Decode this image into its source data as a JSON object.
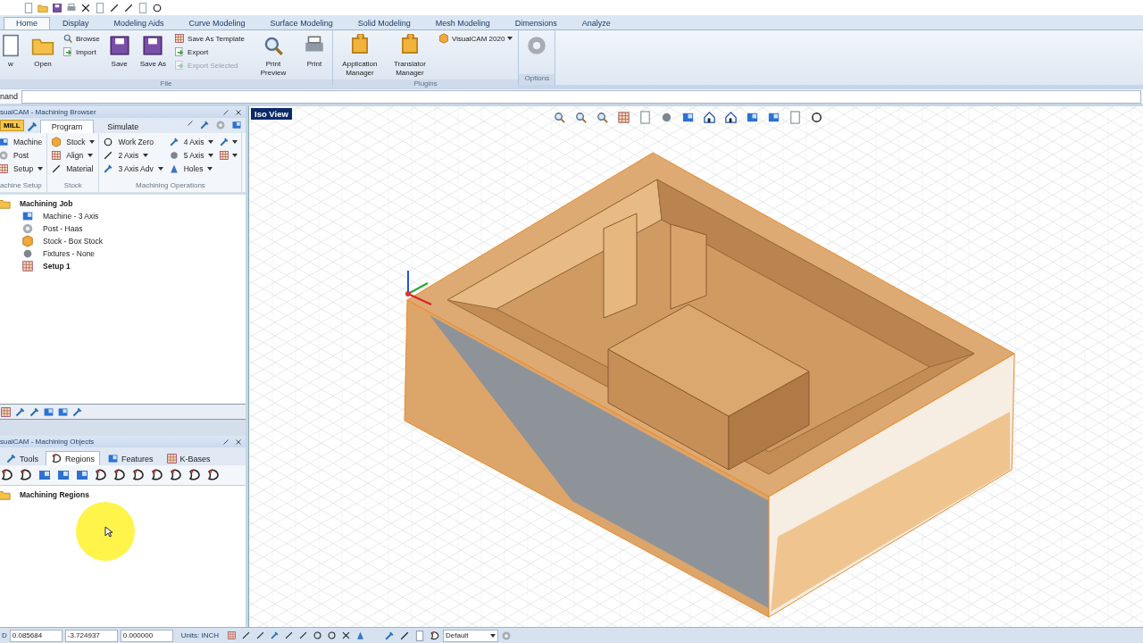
{
  "ribbon": {
    "tabs": [
      {
        "label": "Home",
        "selected": true
      },
      {
        "label": "Display",
        "selected": false
      },
      {
        "label": "Modeling Aids",
        "selected": false
      },
      {
        "label": "Curve Modeling",
        "selected": false
      },
      {
        "label": "Surface Modeling",
        "selected": false
      },
      {
        "label": "Solid Modeling",
        "selected": false
      },
      {
        "label": "Mesh Modeling",
        "selected": false
      },
      {
        "label": "Dimensions",
        "selected": false
      },
      {
        "label": "Analyze",
        "selected": false
      }
    ],
    "groups": [
      {
        "label": "File",
        "items": [
          {
            "label": "w",
            "kind": "large",
            "disabled": false
          },
          {
            "label": "Open",
            "kind": "large",
            "disabled": false
          },
          {
            "label": "Browse",
            "kind": "small",
            "disabled": false
          },
          {
            "label": "Import",
            "kind": "small",
            "disabled": false
          },
          {
            "label": "Save",
            "kind": "large",
            "disabled": false
          },
          {
            "label": "Save As",
            "kind": "large",
            "disabled": false
          },
          {
            "label": "Save As Template",
            "kind": "small",
            "disabled": false
          },
          {
            "label": "Export",
            "kind": "small",
            "disabled": false
          },
          {
            "label": "Export Selected",
            "kind": "small",
            "disabled": true
          },
          {
            "label": "Print Preview",
            "kind": "large",
            "disabled": false
          },
          {
            "label": "Print",
            "kind": "large",
            "disabled": false
          }
        ]
      },
      {
        "label": "Plugins",
        "items": [
          {
            "label": "Application Manager",
            "kind": "large",
            "disabled": false
          },
          {
            "label": "Translator Manager",
            "kind": "large",
            "disabled": false
          },
          {
            "label": "VisualCAM 2020",
            "kind": "small",
            "disabled": false
          }
        ]
      },
      {
        "label": "Options",
        "items": [
          {
            "kind": "icon",
            "disabled": false
          }
        ]
      }
    ]
  },
  "command": {
    "label": "nand"
  },
  "browser": {
    "title": "sualCAM - Machining Browser",
    "mode": "MILL",
    "tabs": [
      {
        "label": "Program",
        "selected": true
      },
      {
        "label": "Simulate",
        "selected": false
      }
    ],
    "groups": [
      {
        "label": "achine Setup",
        "items": [
          {
            "label": "Machine",
            "dropdown": false
          },
          {
            "label": "Post",
            "dropdown": false
          },
          {
            "label": "Setup",
            "dropdown": true
          }
        ]
      },
      {
        "label": "Stock",
        "items": [
          {
            "label": "Stock",
            "dropdown": true
          },
          {
            "label": "Align",
            "dropdown": true
          },
          {
            "label": "Material",
            "dropdown": false
          }
        ]
      },
      {
        "label": "Machining Operations",
        "items": [
          {
            "label": "Work Zero",
            "dropdown": false
          },
          {
            "label": "2 Axis",
            "dropdown": true
          },
          {
            "label": "3 Axis Adv",
            "dropdown": true
          },
          {
            "label": "4 Axis",
            "dropdown": true
          },
          {
            "label": "5 Axis",
            "dropdown": true
          },
          {
            "label": "Holes",
            "dropdown": true
          }
        ]
      }
    ],
    "tree": [
      {
        "label": "Machining Job",
        "bold": true,
        "children": [
          {
            "label": "Machine - 3 Axis",
            "bold": false
          },
          {
            "label": "Post - Haas",
            "bold": false
          },
          {
            "label": "Stock - Box Stock",
            "bold": false
          },
          {
            "label": "Fixtures - None",
            "bold": false
          },
          {
            "label": "Setup 1",
            "bold": true
          }
        ]
      }
    ]
  },
  "objects": {
    "title": "sualCAM - Machining Objects",
    "tabs": [
      {
        "label": "Tools",
        "selected": false
      },
      {
        "label": "Regions",
        "selected": true
      },
      {
        "label": "Features",
        "selected": false
      },
      {
        "label": "K-Bases",
        "selected": false
      }
    ],
    "tree": [
      {
        "label": "Machining Regions",
        "bold": true
      }
    ]
  },
  "viewport": {
    "label": "Iso View"
  },
  "status_bar": {
    "prefix": "D",
    "fields": [
      "0.085684",
      "-3.724937",
      "0.000000"
    ],
    "units": "Units: INCH",
    "layer": "Default"
  }
}
